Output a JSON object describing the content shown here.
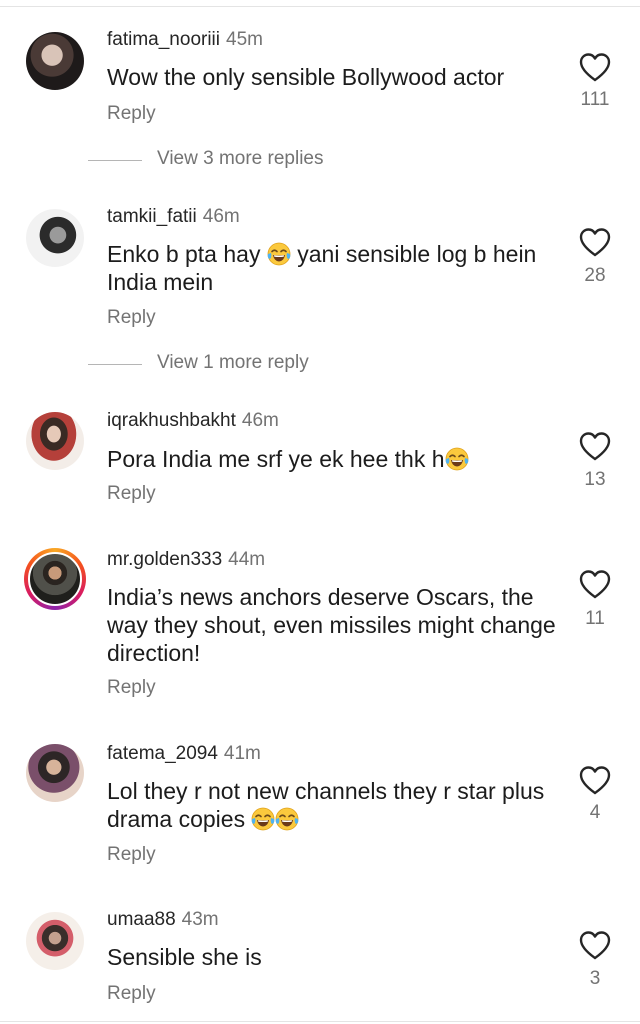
{
  "comments": [
    {
      "username": "fatima_nooriii",
      "time": "45m",
      "text_parts": [
        "Wow the only sensible Bollywood actor"
      ],
      "reply": "Reply",
      "likes": "111",
      "more_replies": "View 3 more replies"
    },
    {
      "username": "tamkii_fatii",
      "time": "46m",
      "text_parts": [
        "Enko b pta hay ",
        " yani sensible log b hein India mein"
      ],
      "reply": "Reply",
      "likes": "28",
      "more_replies": "View 1 more reply"
    },
    {
      "username": "iqrakhushbakht",
      "time": "46m",
      "text_parts": [
        "Pora India me srf ye ek hee thk h"
      ],
      "reply": "Reply",
      "likes": "13"
    },
    {
      "username": "mr.golden333",
      "time": "44m",
      "text_parts": [
        "India’s news anchors deserve Oscars, the way they shout, even missiles might change direction!"
      ],
      "reply": "Reply",
      "likes": "11"
    },
    {
      "username": "fatema_2094",
      "time": "41m",
      "text_parts": [
        "Lol they r not new channels they r star plus drama copies "
      ],
      "reply": "Reply",
      "likes": "4"
    },
    {
      "username": "umaa88",
      "time": "43m",
      "text_parts": [
        "Sensible she is"
      ],
      "reply": "Reply",
      "likes": "3"
    }
  ],
  "icons": {
    "like": "heart-outline-icon",
    "emoji": "face-with-tears-of-joy-emoji"
  },
  "colors": {
    "text": "#1c1c1c",
    "secondary": "#737373",
    "divider": "#e4e4e4"
  }
}
